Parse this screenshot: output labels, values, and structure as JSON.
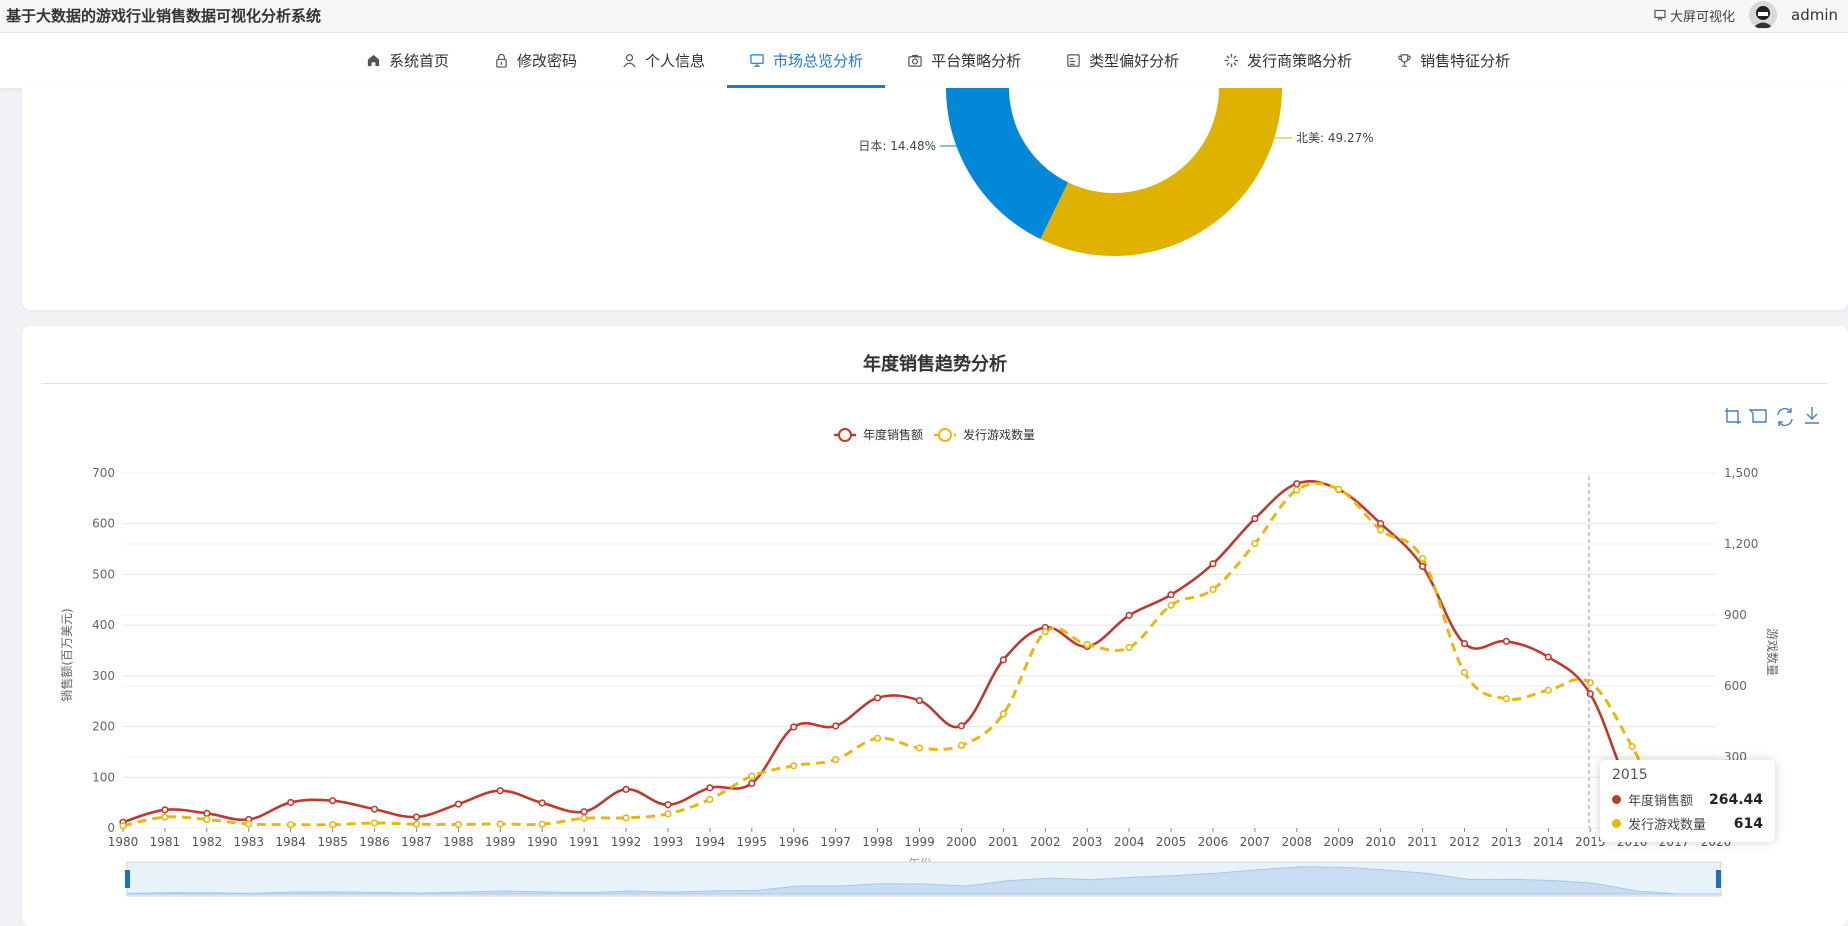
{
  "app": {
    "title": "基于大数据的游戏行业销售数据可视化分析系统",
    "bigscreen_label": "大屏可视化",
    "username": "admin"
  },
  "nav": {
    "items": [
      {
        "label": "系统首页",
        "icon": "home-icon"
      },
      {
        "label": "修改密码",
        "icon": "lock-icon"
      },
      {
        "label": "个人信息",
        "icon": "user-icon"
      },
      {
        "label": "市场总览分析",
        "icon": "monitor-icon",
        "active": true
      },
      {
        "label": "平台策略分析",
        "icon": "camera-icon"
      },
      {
        "label": "类型偏好分析",
        "icon": "image-icon"
      },
      {
        "label": "发行商策略分析",
        "icon": "loading-icon"
      },
      {
        "label": "销售特征分析",
        "icon": "trophy-icon"
      }
    ],
    "active_color": "#1e7ad6"
  },
  "pie_labels": {
    "japan": "日本: 14.48%",
    "north_america": "北美: 49.27%"
  },
  "pie_colors": {
    "japan": "#0288d9",
    "north_america": "#e0b200"
  },
  "chart_data": {
    "type": "line",
    "title": "年度销售趋势分析",
    "xlabel": "年份",
    "ylabel": "销售额(百万美元)",
    "ylabel_right": "游戏数量",
    "categories": [
      "1980",
      "1981",
      "1982",
      "1983",
      "1984",
      "1985",
      "1986",
      "1987",
      "1988",
      "1989",
      "1990",
      "1991",
      "1992",
      "1993",
      "1994",
      "1995",
      "1996",
      "1997",
      "1998",
      "1999",
      "2000",
      "2001",
      "2002",
      "2003",
      "2004",
      "2005",
      "2006",
      "2007",
      "2008",
      "2009",
      "2010",
      "2011",
      "2012",
      "2013",
      "2014",
      "2015",
      "2016",
      "2017",
      "2020"
    ],
    "ylim": [
      0,
      700
    ],
    "yticks": [
      "0",
      "100",
      "200",
      "300",
      "400",
      "500",
      "600",
      "700"
    ],
    "ylim_right": [
      0,
      1500
    ],
    "yticks_right": [
      "0",
      "300",
      "600",
      "900",
      "1,200",
      "1,500"
    ],
    "series": [
      {
        "name": "年度销售额",
        "axis": "left",
        "color": "#c0392b",
        "style": "solid",
        "values": [
          11.4,
          35.8,
          28.9,
          16.8,
          50.4,
          53.9,
          37.1,
          21.7,
          47.2,
          73.5,
          49.4,
          32.2,
          76.2,
          45.9,
          79.2,
          88.1,
          199.2,
          201.1,
          256.5,
          251.3,
          201.4,
          331.5,
          395.5,
          357.9,
          419.3,
          459.9,
          521.0,
          610.0,
          678.9,
          667.3,
          600.3,
          515.8,
          363.5,
          368.1,
          337.1,
          264.4,
          70.9,
          0.1,
          0.3
        ]
      },
      {
        "name": "发行游戏数量",
        "axis": "right",
        "color": "#e8b90c",
        "style": "dashed",
        "values": [
          9,
          46,
          36,
          17,
          14,
          14,
          21,
          16,
          15,
          17,
          16,
          41,
          43,
          60,
          121,
          219,
          263,
          289,
          379,
          338,
          349,
          482,
          829,
          775,
          763,
          941,
          1008,
          1202,
          1428,
          1431,
          1259,
          1139,
          657,
          546,
          582,
          614,
          344,
          3,
          1
        ]
      }
    ],
    "legend_position": "top-center",
    "grid": true,
    "datazoom": true
  },
  "tooltip": {
    "year": "2015",
    "rows": [
      {
        "name": "年度销售额",
        "value": "264.44"
      },
      {
        "name": "发行游戏数量",
        "value": "614"
      }
    ]
  }
}
